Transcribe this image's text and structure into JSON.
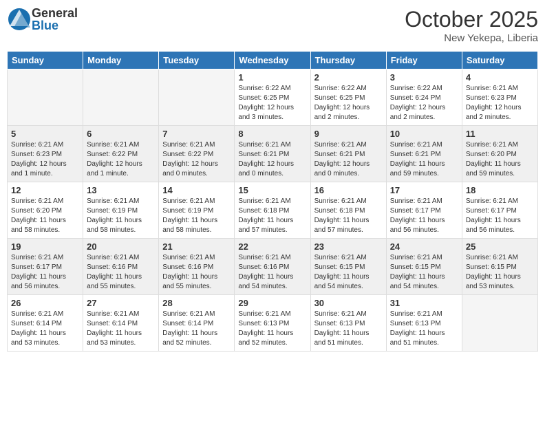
{
  "header": {
    "logo_general": "General",
    "logo_blue": "Blue",
    "month": "October 2025",
    "location": "New Yekepa, Liberia"
  },
  "weekdays": [
    "Sunday",
    "Monday",
    "Tuesday",
    "Wednesday",
    "Thursday",
    "Friday",
    "Saturday"
  ],
  "weeks": [
    [
      {
        "day": "",
        "empty": true
      },
      {
        "day": "",
        "empty": true
      },
      {
        "day": "",
        "empty": true
      },
      {
        "day": "1",
        "sunrise": "Sunrise: 6:22 AM",
        "sunset": "Sunset: 6:25 PM",
        "daylight": "Daylight: 12 hours and 3 minutes."
      },
      {
        "day": "2",
        "sunrise": "Sunrise: 6:22 AM",
        "sunset": "Sunset: 6:25 PM",
        "daylight": "Daylight: 12 hours and 2 minutes."
      },
      {
        "day": "3",
        "sunrise": "Sunrise: 6:22 AM",
        "sunset": "Sunset: 6:24 PM",
        "daylight": "Daylight: 12 hours and 2 minutes."
      },
      {
        "day": "4",
        "sunrise": "Sunrise: 6:21 AM",
        "sunset": "Sunset: 6:23 PM",
        "daylight": "Daylight: 12 hours and 2 minutes."
      }
    ],
    [
      {
        "day": "5",
        "sunrise": "Sunrise: 6:21 AM",
        "sunset": "Sunset: 6:23 PM",
        "daylight": "Daylight: 12 hours and 1 minute."
      },
      {
        "day": "6",
        "sunrise": "Sunrise: 6:21 AM",
        "sunset": "Sunset: 6:22 PM",
        "daylight": "Daylight: 12 hours and 1 minute."
      },
      {
        "day": "7",
        "sunrise": "Sunrise: 6:21 AM",
        "sunset": "Sunset: 6:22 PM",
        "daylight": "Daylight: 12 hours and 0 minutes."
      },
      {
        "day": "8",
        "sunrise": "Sunrise: 6:21 AM",
        "sunset": "Sunset: 6:21 PM",
        "daylight": "Daylight: 12 hours and 0 minutes."
      },
      {
        "day": "9",
        "sunrise": "Sunrise: 6:21 AM",
        "sunset": "Sunset: 6:21 PM",
        "daylight": "Daylight: 12 hours and 0 minutes."
      },
      {
        "day": "10",
        "sunrise": "Sunrise: 6:21 AM",
        "sunset": "Sunset: 6:21 PM",
        "daylight": "Daylight: 11 hours and 59 minutes."
      },
      {
        "day": "11",
        "sunrise": "Sunrise: 6:21 AM",
        "sunset": "Sunset: 6:20 PM",
        "daylight": "Daylight: 11 hours and 59 minutes."
      }
    ],
    [
      {
        "day": "12",
        "sunrise": "Sunrise: 6:21 AM",
        "sunset": "Sunset: 6:20 PM",
        "daylight": "Daylight: 11 hours and 58 minutes."
      },
      {
        "day": "13",
        "sunrise": "Sunrise: 6:21 AM",
        "sunset": "Sunset: 6:19 PM",
        "daylight": "Daylight: 11 hours and 58 minutes."
      },
      {
        "day": "14",
        "sunrise": "Sunrise: 6:21 AM",
        "sunset": "Sunset: 6:19 PM",
        "daylight": "Daylight: 11 hours and 58 minutes."
      },
      {
        "day": "15",
        "sunrise": "Sunrise: 6:21 AM",
        "sunset": "Sunset: 6:18 PM",
        "daylight": "Daylight: 11 hours and 57 minutes."
      },
      {
        "day": "16",
        "sunrise": "Sunrise: 6:21 AM",
        "sunset": "Sunset: 6:18 PM",
        "daylight": "Daylight: 11 hours and 57 minutes."
      },
      {
        "day": "17",
        "sunrise": "Sunrise: 6:21 AM",
        "sunset": "Sunset: 6:17 PM",
        "daylight": "Daylight: 11 hours and 56 minutes."
      },
      {
        "day": "18",
        "sunrise": "Sunrise: 6:21 AM",
        "sunset": "Sunset: 6:17 PM",
        "daylight": "Daylight: 11 hours and 56 minutes."
      }
    ],
    [
      {
        "day": "19",
        "sunrise": "Sunrise: 6:21 AM",
        "sunset": "Sunset: 6:17 PM",
        "daylight": "Daylight: 11 hours and 56 minutes."
      },
      {
        "day": "20",
        "sunrise": "Sunrise: 6:21 AM",
        "sunset": "Sunset: 6:16 PM",
        "daylight": "Daylight: 11 hours and 55 minutes."
      },
      {
        "day": "21",
        "sunrise": "Sunrise: 6:21 AM",
        "sunset": "Sunset: 6:16 PM",
        "daylight": "Daylight: 11 hours and 55 minutes."
      },
      {
        "day": "22",
        "sunrise": "Sunrise: 6:21 AM",
        "sunset": "Sunset: 6:16 PM",
        "daylight": "Daylight: 11 hours and 54 minutes."
      },
      {
        "day": "23",
        "sunrise": "Sunrise: 6:21 AM",
        "sunset": "Sunset: 6:15 PM",
        "daylight": "Daylight: 11 hours and 54 minutes."
      },
      {
        "day": "24",
        "sunrise": "Sunrise: 6:21 AM",
        "sunset": "Sunset: 6:15 PM",
        "daylight": "Daylight: 11 hours and 54 minutes."
      },
      {
        "day": "25",
        "sunrise": "Sunrise: 6:21 AM",
        "sunset": "Sunset: 6:15 PM",
        "daylight": "Daylight: 11 hours and 53 minutes."
      }
    ],
    [
      {
        "day": "26",
        "sunrise": "Sunrise: 6:21 AM",
        "sunset": "Sunset: 6:14 PM",
        "daylight": "Daylight: 11 hours and 53 minutes."
      },
      {
        "day": "27",
        "sunrise": "Sunrise: 6:21 AM",
        "sunset": "Sunset: 6:14 PM",
        "daylight": "Daylight: 11 hours and 53 minutes."
      },
      {
        "day": "28",
        "sunrise": "Sunrise: 6:21 AM",
        "sunset": "Sunset: 6:14 PM",
        "daylight": "Daylight: 11 hours and 52 minutes."
      },
      {
        "day": "29",
        "sunrise": "Sunrise: 6:21 AM",
        "sunset": "Sunset: 6:13 PM",
        "daylight": "Daylight: 11 hours and 52 minutes."
      },
      {
        "day": "30",
        "sunrise": "Sunrise: 6:21 AM",
        "sunset": "Sunset: 6:13 PM",
        "daylight": "Daylight: 11 hours and 51 minutes."
      },
      {
        "day": "31",
        "sunrise": "Sunrise: 6:21 AM",
        "sunset": "Sunset: 6:13 PM",
        "daylight": "Daylight: 11 hours and 51 minutes."
      },
      {
        "day": "",
        "empty": true
      }
    ]
  ]
}
